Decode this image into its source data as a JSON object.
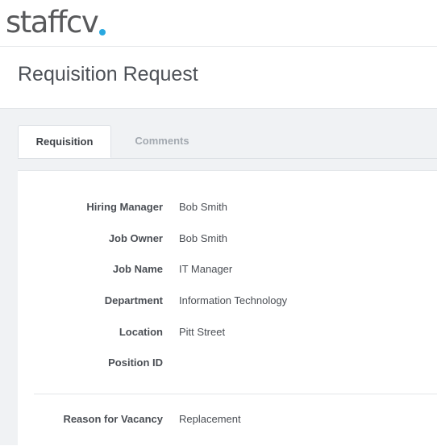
{
  "brand": {
    "name": "staffcv",
    "accent_color": "#29a8e0"
  },
  "header": {
    "title": "Requisition Request"
  },
  "tabs": [
    {
      "label": "Requisition",
      "active": true
    },
    {
      "label": "Comments",
      "active": false
    }
  ],
  "requisition": {
    "fields": [
      {
        "label": "Hiring Manager",
        "value": "Bob Smith"
      },
      {
        "label": "Job Owner",
        "value": "Bob Smith"
      },
      {
        "label": "Job Name",
        "value": "IT Manager"
      },
      {
        "label": "Department",
        "value": "Information Technology"
      },
      {
        "label": "Location",
        "value": "Pitt Street"
      },
      {
        "label": "Position ID",
        "value": ""
      }
    ],
    "vacancy_fields": [
      {
        "label": "Reason for Vacancy",
        "value": "Replacement"
      }
    ]
  }
}
